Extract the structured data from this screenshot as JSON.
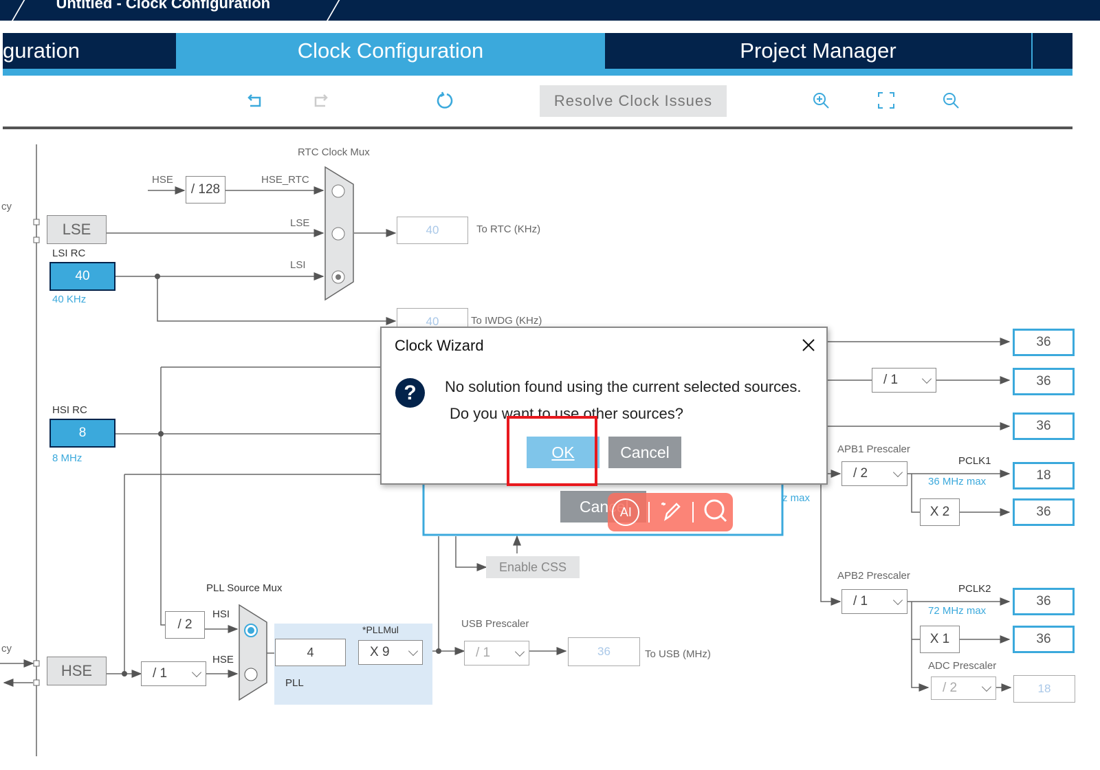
{
  "window": {
    "title": "Untitled - Clock Configuration"
  },
  "tabs": [
    {
      "label": "guration"
    },
    {
      "label": "Clock Configuration",
      "active": true
    },
    {
      "label": "Project Manager"
    }
  ],
  "toolbar": {
    "undo": "undo-icon",
    "redo": "redo-icon",
    "refresh": "refresh-icon",
    "resolve_label": "Resolve Clock Issues",
    "zoom_in": "zoom-in-icon",
    "fit": "fullscreen-icon",
    "zoom_out": "zoom-out-icon"
  },
  "diagram": {
    "rtc_mux_label": "RTC Clock Mux",
    "hse_label": "HSE",
    "div128": "/ 128",
    "hse_rtc": "HSE_RTC",
    "lse_line": "LSE",
    "lsi_line": "LSI",
    "lse_box": "LSE",
    "lsi_rc_label": "LSI RC",
    "lsi_value": "40",
    "lsi_freq": "40 KHz",
    "cy_label_top": "cy",
    "cy_label_bottom": "cy",
    "rtc_value": "40",
    "rtc_label": "To RTC (KHz)",
    "iwdg_value": "40",
    "iwdg_label": "To IWDG (KHz)",
    "hsi_rc_label": "HSI RC",
    "hsi_value": "8",
    "hsi_freq": "8 MHz",
    "hse_box": "HSE",
    "hse_div": "/ 1",
    "pll_mux_label": "PLL Source Mux",
    "hsi_div": "/ 2",
    "pll_hsi": "HSI",
    "pll_hse": "HSE",
    "pll_in": "4",
    "pllmul_label": "*PLLMul",
    "pllmul": "X 9",
    "pll_label": "PLL",
    "usb_prescaler_label": "USB Prescaler",
    "usb_div": "/ 1",
    "usb_value": "36",
    "usb_label": "To USB (MHz)",
    "enable_css": "Enable CSS",
    "behind_cancel": "Cancel",
    "behind_max": "z max",
    "out1": "36",
    "ahb_div": "/ 1",
    "out2": "36",
    "out3": "36",
    "apb1_label": "APB1 Prescaler",
    "apb1_div": "/ 2",
    "pclk1": "PCLK1",
    "pclk1_max": "36 MHz max",
    "pclk1_value": "18",
    "apb1_timer_mul": "X 2",
    "apb1_timer": "36",
    "apb2_label": "APB2 Prescaler",
    "apb2_div": "/ 1",
    "pclk2": "PCLK2",
    "pclk2_max": "72 MHz max",
    "pclk2_value": "36",
    "apb2_timer_mul": "X 1",
    "apb2_timer": "36",
    "adc_label": "ADC Prescaler",
    "adc_div": "/ 2",
    "adc_value": "18"
  },
  "dialog": {
    "title": "Clock Wizard",
    "icon": "question-icon",
    "line1": "No solution found using the current selected sources.",
    "line2": "Do you want to use other sources?",
    "ok": "OK",
    "cancel": "Cancel"
  },
  "overlay_toolbar": {
    "ai": "AI",
    "icons": [
      "ai-chat-icon",
      "magic-pen-icon",
      "search-icon"
    ]
  },
  "colors": {
    "navy": "#03234b",
    "accent": "#3ba9dc",
    "highlight": "#e8191e",
    "overlay": "#fa7d6e"
  }
}
